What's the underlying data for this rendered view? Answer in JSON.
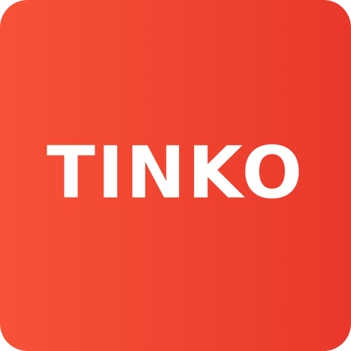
{
  "logo": {
    "text": "TINKO"
  },
  "colors": {
    "gradient_start": "#f75237",
    "gradient_end": "#e9382a",
    "text": "#ffffff"
  }
}
